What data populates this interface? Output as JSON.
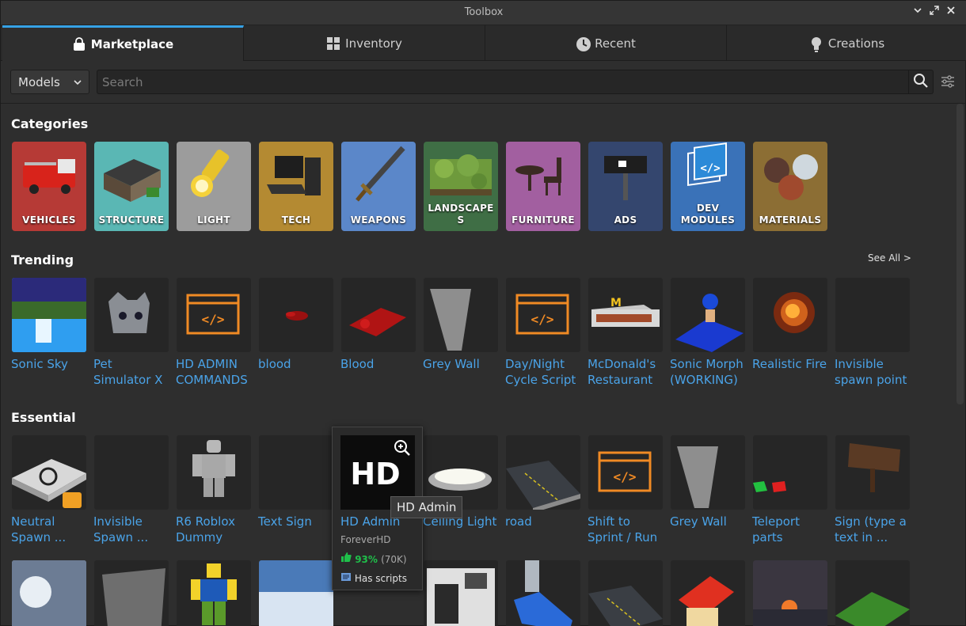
{
  "window": {
    "title": "Toolbox"
  },
  "tabs": [
    {
      "label": "Marketplace",
      "icon": "shopping-bag-icon"
    },
    {
      "label": "Inventory",
      "icon": "grid-icon"
    },
    {
      "label": "Recent",
      "icon": "clock-icon"
    },
    {
      "label": "Creations",
      "icon": "lightbulb-icon"
    }
  ],
  "search": {
    "category_value": "Models",
    "placeholder": "Search"
  },
  "sections": {
    "categories": "Categories",
    "trending": "Trending",
    "essential": "Essential",
    "see_all": "See All >"
  },
  "categories": [
    {
      "label": "VEHICLES",
      "color": "#b63a36"
    },
    {
      "label": "STRUCTURE",
      "color": "#5ab7b4"
    },
    {
      "label": "LIGHT",
      "color": "#9c9c9c"
    },
    {
      "label": "TECH",
      "color": "#b48a32"
    },
    {
      "label": "WEAPONS",
      "color": "#5b87c9"
    },
    {
      "label": "LANDSCAPE\nS",
      "color": "#3f6e45"
    },
    {
      "label": "FURNITURE",
      "color": "#a25fa0"
    },
    {
      "label": "ADS",
      "color": "#34466e"
    },
    {
      "label": "DEV\nMODULES",
      "color": "#3a72b8"
    },
    {
      "label": "MATERIALS",
      "color": "#8c6e34"
    }
  ],
  "trending": [
    {
      "name": "Sonic Sky",
      "icon": "sky-image"
    },
    {
      "name": "Pet Simulator X",
      "icon": "cat-icon"
    },
    {
      "name": "HD ADMIN COMMANDS",
      "icon": "script-icon"
    },
    {
      "name": "blood",
      "icon": "blood-splat"
    },
    {
      "name": "Blood",
      "icon": "blood-splat"
    },
    {
      "name": "Grey Wall",
      "icon": "wall-model"
    },
    {
      "name": "Day/Night Cycle Script",
      "icon": "script-icon"
    },
    {
      "name": "McDonald's Restaurant",
      "icon": "building-model"
    },
    {
      "name": "Sonic Morph (WORKING)",
      "icon": "sonic-model"
    },
    {
      "name": "Realistic Fire",
      "icon": "fire-effect"
    },
    {
      "name": "Invisible spawn point",
      "icon": "empty"
    }
  ],
  "essential": [
    {
      "name": "Neutral Spawn ...",
      "icon": "spawn-pad"
    },
    {
      "name": "Invisible Spawn ...",
      "icon": "empty"
    },
    {
      "name": "R6 Roblox Dummy",
      "icon": "dummy-model"
    },
    {
      "name": "Text Sign",
      "icon": "empty"
    },
    {
      "name": "HD Admin",
      "icon": "hd-logo"
    },
    {
      "name": "Ceiling Light",
      "icon": "ceiling-light"
    },
    {
      "name": "road",
      "icon": "road-model"
    },
    {
      "name": "Shift to Sprint / Run",
      "icon": "script-icon"
    },
    {
      "name": "Grey Wall",
      "icon": "wall-model"
    },
    {
      "name": "Teleport parts",
      "icon": "teleport-pads"
    },
    {
      "name": "Sign (type a text in ...",
      "icon": "wooden-sign"
    }
  ],
  "hovercard": {
    "name": "HD Admin",
    "creator": "ForeverHD",
    "rating": "93%",
    "votes": "(70K)",
    "scripts": "Has scripts",
    "tooltip": "HD Admin",
    "logo_text": "HD"
  },
  "colors": {
    "accent": "#36a2e6",
    "link": "#4aa3e8",
    "positive": "#1fbf4a"
  }
}
